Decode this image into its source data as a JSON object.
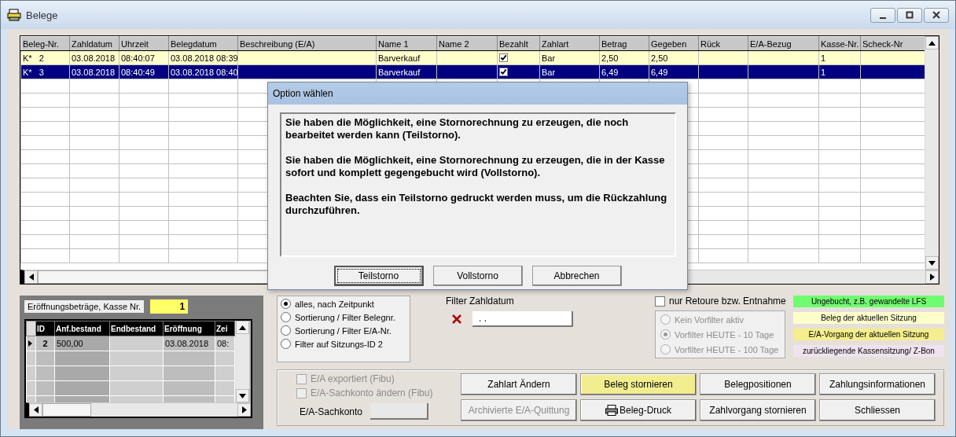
{
  "window": {
    "title": "Belege"
  },
  "table": {
    "columns": [
      {
        "label": "Beleg-Nr.",
        "kind": "text"
      },
      {
        "label": "Zahldatum",
        "kind": "text"
      },
      {
        "label": "Uhrzeit",
        "kind": "text"
      },
      {
        "label": "Belegdatum",
        "kind": "text"
      },
      {
        "label": "Beschreibung (E/A)",
        "kind": "text"
      },
      {
        "label": "Name 1",
        "kind": "text"
      },
      {
        "label": "Name 2",
        "kind": "text"
      },
      {
        "label": "Bezahlt",
        "kind": "check"
      },
      {
        "label": "Zahlart",
        "kind": "text"
      },
      {
        "label": "Betrag",
        "kind": "text"
      },
      {
        "label": "Gegeben",
        "kind": "text"
      },
      {
        "label": "Rück",
        "kind": "text"
      },
      {
        "label": "E/A-Bezug",
        "kind": "text"
      },
      {
        "label": "Kasse-Nr.",
        "kind": "text"
      },
      {
        "label": "Scheck-Nr",
        "kind": "text"
      }
    ],
    "rows": [
      {
        "selected": false,
        "color": "#ffffcc",
        "cells": [
          "K*   2",
          "03.08.2018",
          "08:40:07",
          "03.08.2018 08:39",
          null,
          "Barverkauf",
          null,
          true,
          "Bar",
          "2,50",
          "2,50",
          null,
          null,
          "1",
          null
        ]
      },
      {
        "selected": true,
        "cells": [
          "K*   3",
          "03.08.2018",
          "08:40:49",
          "03.08.2018 08:40",
          null,
          "Barverkauf",
          null,
          true,
          "Bar",
          "6,49",
          "6,49",
          null,
          null,
          "1",
          null
        ]
      }
    ]
  },
  "opening": {
    "label": "Eröffnungsbeträge, Kasse Nr.",
    "kasse": "1",
    "columns": [
      "ID",
      "Anf.bestand",
      "Endbestand",
      "Eröffnung",
      "Zei"
    ],
    "rows": [
      {
        "selected": true,
        "cells": [
          "2",
          "500,00",
          null,
          "03.08.2018",
          "08:"
        ]
      }
    ]
  },
  "sort_options": [
    {
      "label": "alles, nach Zeitpunkt",
      "selected": true
    },
    {
      "label": "Sortierung / Filter Belegnr.",
      "selected": false
    },
    {
      "label": "Sortierung / Filter E/A-Nr.",
      "selected": false
    },
    {
      "label": "Filter auf Sitzungs-ID 2",
      "selected": false
    }
  ],
  "date_filter": {
    "label": "Filter Zahldatum",
    "value": ". ."
  },
  "retoure": {
    "label": "nur Retoure bzw. Entnahme",
    "checked": false
  },
  "prefilter": {
    "disabled": true,
    "options": [
      {
        "label": "Kein Vorfilter aktiv",
        "selected": false
      },
      {
        "label": "Vorfilter HEUTE - 10 Tage",
        "selected": true
      },
      {
        "label": "Vorfilter HEUTE - 100 Tage",
        "selected": false
      }
    ]
  },
  "legend": [
    {
      "label": "Ungebucht, z.B. gewandelte LFS",
      "color": "#70fc70"
    },
    {
      "label": "Beleg der aktuellen Sitzung",
      "color": "#ffffcc"
    },
    {
      "label": "E/A-Vorgang der aktuellen Sitzung",
      "color": "#f4ee8c"
    },
    {
      "label": "zurückliegende Kassensitzung/ Z-Bon",
      "color": "#efe3ef"
    }
  ],
  "options": [
    {
      "label": "E/A exportiert (Fibu)",
      "checked": false,
      "disabled": true
    },
    {
      "label": "E/A-Sachkonto ändern (Fibu)",
      "checked": false,
      "disabled": true
    }
  ],
  "sachkonto": {
    "label": "E/A-Sachkonto"
  },
  "buttons": [
    {
      "label": "Zahlart Ändern",
      "highlighted": false,
      "disabled": false
    },
    {
      "label": "Beleg stornieren",
      "highlighted": true,
      "disabled": false
    },
    {
      "label": "Belegpositionen",
      "highlighted": false,
      "disabled": false
    },
    {
      "label": "Zahlungsinformationen",
      "highlighted": false,
      "disabled": false
    },
    {
      "label": "Archivierte E/A-Quittung",
      "highlighted": false,
      "disabled": true
    },
    {
      "label": "Beleg-Druck",
      "highlighted": false,
      "disabled": false,
      "kind": "printer"
    },
    {
      "label": "Zahlvorgang stornieren",
      "highlighted": false,
      "disabled": false
    },
    {
      "label": "Schliessen",
      "highlighted": false,
      "disabled": false
    }
  ],
  "dialog": {
    "title": "Option wählen",
    "paragraphs": [
      "Sie haben die Möglichkeit, eine Stornorechnung zu erzeugen, die noch bearbeitet werden kann (Teilstorno).",
      "Sie haben die Möglichkeit, eine Stornorechnung zu erzeugen, die in der Kasse sofort und komplett gegengebucht wird (Vollstorno).",
      "Beachten Sie, dass ein Teilstorno gedruckt werden muss, um die Rückzahlung durchzuführen."
    ],
    "buttons": [
      {
        "label": "Teilstorno",
        "focused": true
      },
      {
        "label": "Vollstorno",
        "focused": false
      },
      {
        "label": "Abbrechen",
        "focused": false
      }
    ]
  }
}
